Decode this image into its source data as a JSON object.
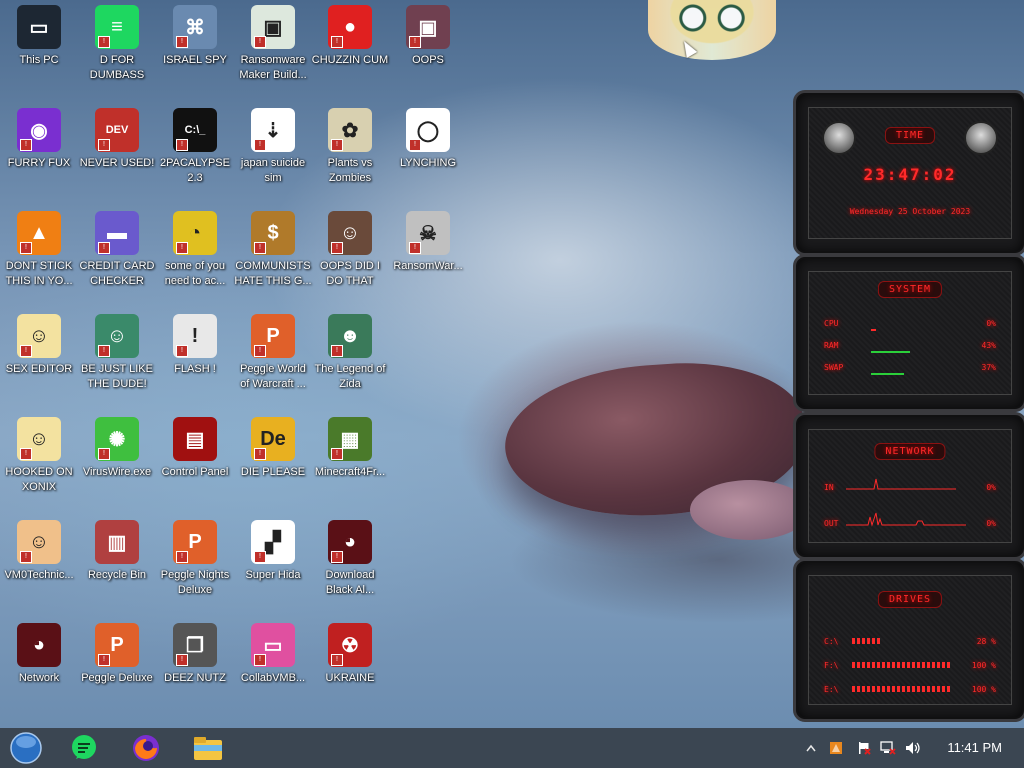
{
  "desktop_icons": [
    {
      "label": "This PC",
      "icon": "monitor-icon"
    },
    {
      "label": "FURRY FUX",
      "icon": "firefox-icon"
    },
    {
      "label": "DONT STICK THIS IN YO...",
      "icon": "vlc-cone-icon"
    },
    {
      "label": "SEX EDITOR",
      "icon": "cartoon-icon"
    },
    {
      "label": "HOOKED ON XONIX",
      "icon": "cartoon-icon"
    },
    {
      "label": "VM0Technic...",
      "icon": "doctor-icon"
    },
    {
      "label": "Network",
      "icon": "alien-network-icon"
    },
    {
      "label": "D FOR DUMBASS",
      "icon": "chat-icon"
    },
    {
      "label": "NEVER USED!",
      "icon": "devcpp-icon"
    },
    {
      "label": "CREDIT CARD CHECKER",
      "icon": "credit-card-icon"
    },
    {
      "label": "BE JUST LIKE THE DUDE!",
      "icon": "elf-icon"
    },
    {
      "label": "VirusWire.exe",
      "icon": "lime-icon"
    },
    {
      "label": "Recycle Bin",
      "icon": "trash-icon"
    },
    {
      "label": "Peggle Deluxe",
      "icon": "peggle-icon"
    },
    {
      "label": "ISRAEL SPY",
      "icon": "network-spy-icon"
    },
    {
      "label": "2PACALYPSE 2.3",
      "icon": "terminal-icon"
    },
    {
      "label": "some of you need to ac...",
      "icon": "dog-icon"
    },
    {
      "label": "FLASH !",
      "icon": "flash-icon"
    },
    {
      "label": "Control Panel",
      "icon": "control-panel-icon"
    },
    {
      "label": "Peggle Nights Deluxe",
      "icon": "peggle-icon"
    },
    {
      "label": "DEEZ NUTZ",
      "icon": "windows-stack-icon"
    },
    {
      "label": "Ransomware Maker Build...",
      "icon": "window-icon"
    },
    {
      "label": "japan suicide sim",
      "icon": "arrows-icon"
    },
    {
      "label": "COMMUNISTS HATE THIS G...",
      "icon": "money-bag-icon"
    },
    {
      "label": "Peggle World of Warcraft ...",
      "icon": "peggle-icon"
    },
    {
      "label": "DIE PLEASE",
      "icon": "de-icon"
    },
    {
      "label": "Super Hida",
      "icon": "pixel-dog-icon"
    },
    {
      "label": "CollabVMB...",
      "icon": "display-icon"
    },
    {
      "label": "CHUZZIN CUM",
      "icon": "chuzzle-icon"
    },
    {
      "label": "Plants vs Zombies",
      "icon": "plant-icon"
    },
    {
      "label": "OOPS DID I DO THAT",
      "icon": "portrait-icon"
    },
    {
      "label": "The Legend of Zida",
      "icon": "pixel-hero-icon"
    },
    {
      "label": "Minecraft4Fr...",
      "icon": "grass-block-icon"
    },
    {
      "label": "Download Black Al...",
      "icon": "alien-network-icon"
    },
    {
      "label": "UKRAINE",
      "icon": "radiation-icon"
    },
    {
      "label": "OOPS",
      "icon": "oops-icon"
    },
    {
      "label": "LYNCHING",
      "icon": "noose-icon"
    },
    {
      "label": "RansomWar...",
      "icon": "skull-ring-icon"
    }
  ],
  "widget": {
    "time": {
      "title": "TIME",
      "clock": "23:47:02",
      "date": "Wednesday 25 October 2023"
    },
    "system": {
      "title": "SYSTEM",
      "rows": [
        {
          "label": "CPU",
          "value": "0%",
          "level": 0.05
        },
        {
          "label": "RAM",
          "value": "43%",
          "level": 0.43
        },
        {
          "label": "SWAP",
          "value": "37%",
          "level": 0.37
        }
      ]
    },
    "network": {
      "title": "NETWORK",
      "rows": [
        {
          "label": "IN",
          "value": "0%"
        },
        {
          "label": "OUT",
          "value": "0%"
        }
      ]
    },
    "drives": {
      "title": "DRIVES",
      "rows": [
        {
          "label": "C:\\",
          "value": "28 %",
          "level": 0.28
        },
        {
          "label": "F:\\",
          "value": "100 %",
          "level": 1.0
        },
        {
          "label": "E:\\",
          "value": "100 %",
          "level": 1.0
        }
      ]
    }
  },
  "taskbar": {
    "start": "start-orb-icon",
    "pinned": [
      "chat-app-icon",
      "firefox-icon",
      "file-explorer-icon"
    ],
    "tray": [
      "chevron-up-icon",
      "security-shield-icon",
      "action-center-flag-icon",
      "network-icon",
      "volume-icon"
    ],
    "clock": "11:41 PM"
  },
  "colors": {
    "accent_red": "#ff2a2a",
    "taskbar": "#3b4652",
    "badge_red": "#c0302a"
  }
}
